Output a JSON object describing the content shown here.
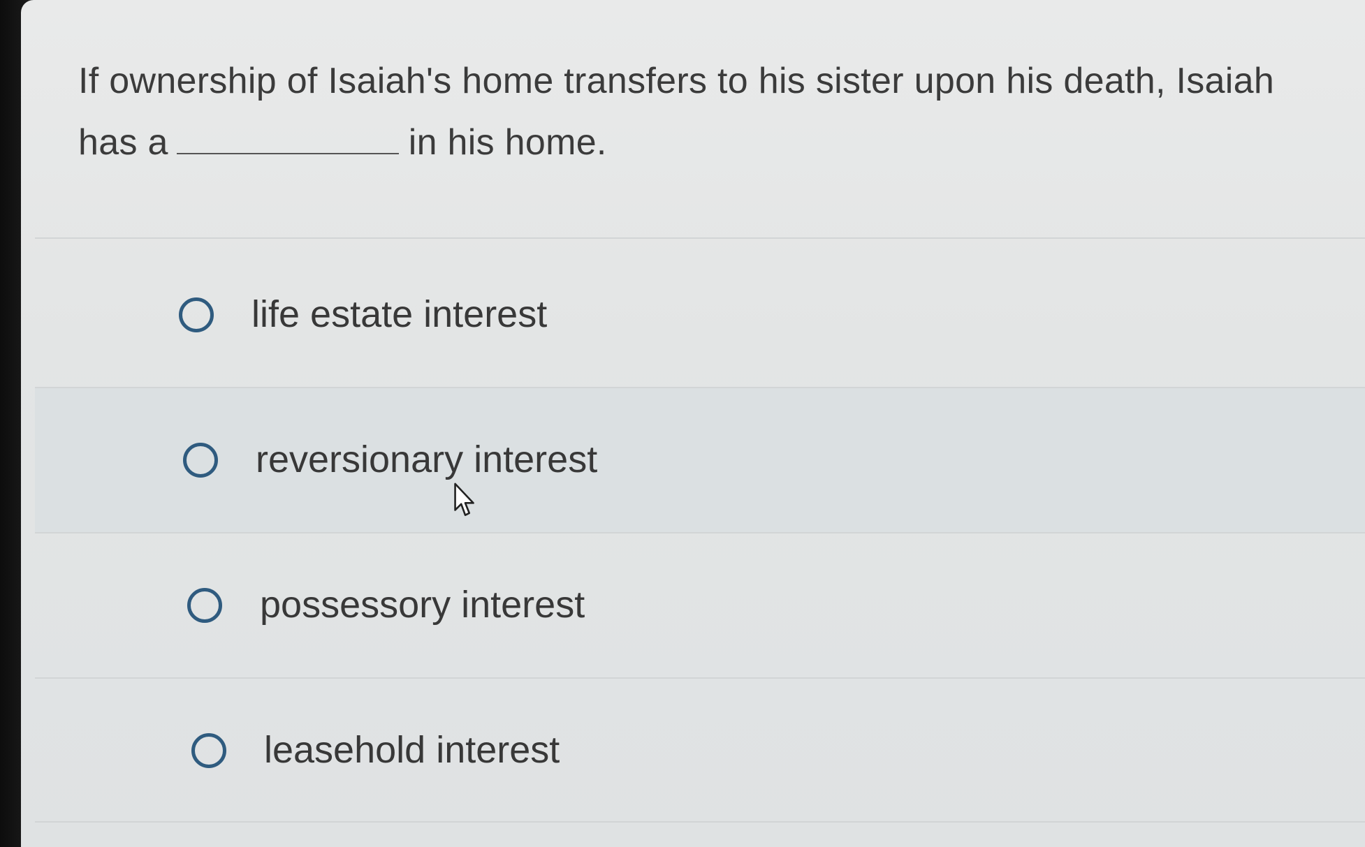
{
  "question": {
    "line1": "If ownership of Isaiah's home transfers to his sister upon his death, Isaiah",
    "prefix": "has a",
    "suffix": "in his home."
  },
  "options": [
    {
      "label": "life estate interest",
      "selected": false
    },
    {
      "label": "reversionary interest",
      "selected": false,
      "hovered": true
    },
    {
      "label": "possessory interest",
      "selected": false
    },
    {
      "label": "leasehold interest",
      "selected": false
    }
  ],
  "colors": {
    "radio_border": "#2f5b7f",
    "text": "#383838",
    "hover_row": "#dbe0e2"
  },
  "icons": {
    "cursor": "arrow-cursor-icon",
    "radio": "radio-unchecked-icon"
  }
}
